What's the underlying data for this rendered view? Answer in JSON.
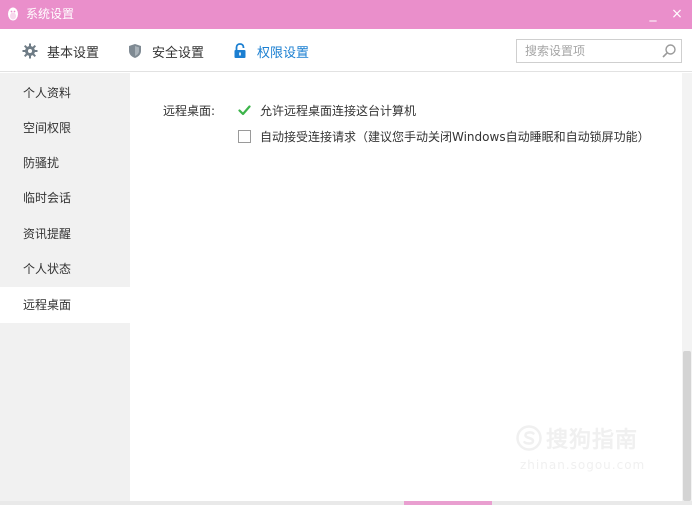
{
  "window": {
    "title": "系统设置",
    "minimize_glyph": "_",
    "close_glyph": "×"
  },
  "toolbar": {
    "tabs": [
      {
        "label": "基本设置",
        "icon": "gear-icon",
        "active": false
      },
      {
        "label": "安全设置",
        "icon": "shield-icon",
        "active": false
      },
      {
        "label": "权限设置",
        "icon": "lock-icon",
        "active": true
      }
    ],
    "search_placeholder": "搜索设置项"
  },
  "sidebar": {
    "items": [
      {
        "label": "个人资料"
      },
      {
        "label": "空间权限"
      },
      {
        "label": "防骚扰"
      },
      {
        "label": "临时会话"
      },
      {
        "label": "资讯提醒"
      },
      {
        "label": "个人状态"
      },
      {
        "label": "远程桌面"
      }
    ],
    "active_index": 6
  },
  "content": {
    "section_label": "远程桌面:",
    "options": [
      {
        "label": "允许远程桌面连接这台计算机",
        "checked": true
      },
      {
        "label": "自动接受连接请求（建议您手动关闭Windows自动睡眠和自动锁屏功能）",
        "checked": false
      }
    ]
  },
  "watermark": {
    "brand": "搜狗指南",
    "url": "zhinan.sogou.com"
  },
  "colors": {
    "titlebar": "#ea8fcb",
    "accent": "#1b7fd1",
    "check": "#3cb44a",
    "sidebar_bg": "#f1f1f1"
  }
}
